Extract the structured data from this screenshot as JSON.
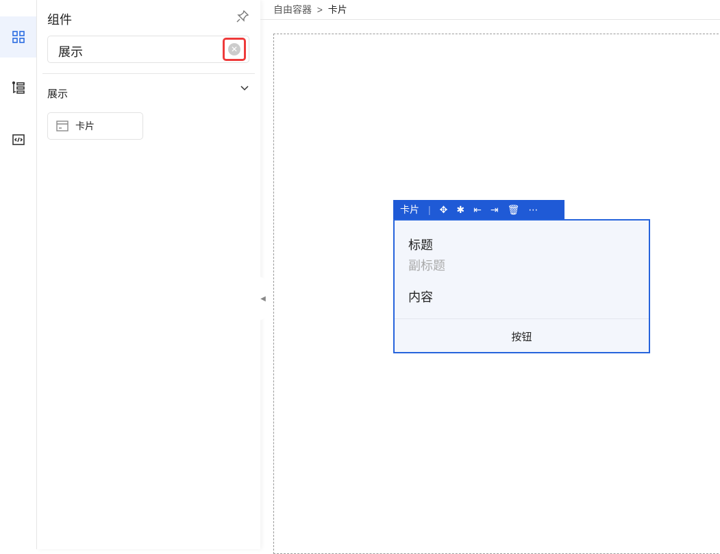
{
  "panel": {
    "title": "组件",
    "search_value": "展示",
    "section": "展示",
    "components": [
      {
        "label": "卡片"
      }
    ]
  },
  "breadcrumb": {
    "root": "自由容器",
    "sep": ">",
    "current": "卡片"
  },
  "toolbar": {
    "label": "卡片",
    "sep": "|",
    "icons": [
      "move-icon",
      "bug-icon",
      "move-left-icon",
      "move-right-icon",
      "trash-icon",
      "more-icon"
    ]
  },
  "card": {
    "title": "标题",
    "subtitle": "副标题",
    "content": "内容",
    "button": "按钮"
  },
  "colors": {
    "accent": "#1f5ad6",
    "highlight": "#ee3a3a"
  }
}
